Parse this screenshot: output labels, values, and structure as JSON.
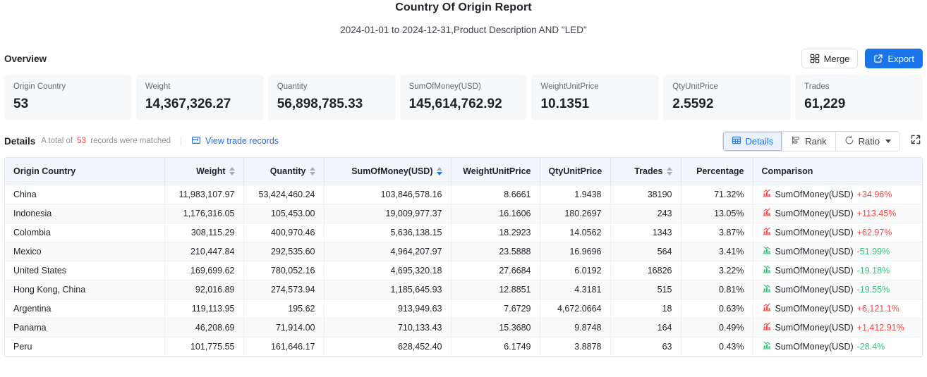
{
  "header": {
    "title": "Country Of Origin Report",
    "subtitle": "2024-01-01 to 2024-12-31,Product Description AND \"LED\""
  },
  "overview": {
    "label": "Overview",
    "merge_label": "Merge",
    "export_label": "Export",
    "cards": [
      {
        "label": "Origin Country",
        "value": "53"
      },
      {
        "label": "Weight",
        "value": "14,367,326.27"
      },
      {
        "label": "Quantity",
        "value": "56,898,785.33"
      },
      {
        "label": "SumOfMoney(USD)",
        "value": "145,614,762.92"
      },
      {
        "label": "WeightUnitPrice",
        "value": "10.1351"
      },
      {
        "label": "QtyUnitPrice",
        "value": "2.5592"
      },
      {
        "label": "Trades",
        "value": "61,229"
      }
    ]
  },
  "details": {
    "title": "Details",
    "meta_prefix": "A total of",
    "count": "53",
    "meta_suffix": "records were matched",
    "view_trade_records": "View trade records",
    "seg_details": "Details",
    "seg_rank": "Rank",
    "seg_ratio": "Ratio"
  },
  "table": {
    "columns": [
      {
        "label": "Origin Country",
        "align": "left",
        "sortable": false,
        "sort": "none"
      },
      {
        "label": "Weight",
        "align": "right",
        "sortable": true,
        "sort": "none"
      },
      {
        "label": "Quantity",
        "align": "right",
        "sortable": true,
        "sort": "none"
      },
      {
        "label": "SumOfMoney(USD)",
        "align": "right",
        "sortable": true,
        "sort": "desc"
      },
      {
        "label": "WeightUnitPrice",
        "align": "right",
        "sortable": false,
        "sort": "none"
      },
      {
        "label": "QtyUnitPrice",
        "align": "right",
        "sortable": false,
        "sort": "none"
      },
      {
        "label": "Trades",
        "align": "right",
        "sortable": true,
        "sort": "none"
      },
      {
        "label": "Percentage",
        "align": "right",
        "sortable": false,
        "sort": "none"
      },
      {
        "label": "Comparison",
        "align": "left",
        "sortable": false,
        "sort": "none"
      }
    ],
    "rows": [
      {
        "country": "China",
        "weight": "11,983,107.97",
        "quantity": "53,424,460.24",
        "sum": "103,846,578.16",
        "wup": "8.6661",
        "qup": "1.9438",
        "trades": "38190",
        "percentage": "71.32%",
        "cmp_label": "SumOfMoney(USD)",
        "cmp_value": "+34.96%",
        "cmp_dir": "up"
      },
      {
        "country": "Indonesia",
        "weight": "1,176,316.05",
        "quantity": "105,453.00",
        "sum": "19,009,977.37",
        "wup": "16.1606",
        "qup": "180.2697",
        "trades": "243",
        "percentage": "13.05%",
        "cmp_label": "SumOfMoney(USD)",
        "cmp_value": "+113.45%",
        "cmp_dir": "up"
      },
      {
        "country": "Colombia",
        "weight": "308,115.29",
        "quantity": "400,970.46",
        "sum": "5,636,138.15",
        "wup": "18.2923",
        "qup": "14.0562",
        "trades": "1343",
        "percentage": "3.87%",
        "cmp_label": "SumOfMoney(USD)",
        "cmp_value": "+62.97%",
        "cmp_dir": "up"
      },
      {
        "country": "Mexico",
        "weight": "210,447.84",
        "quantity": "292,535.60",
        "sum": "4,964,207.97",
        "wup": "23.5888",
        "qup": "16.9696",
        "trades": "564",
        "percentage": "3.41%",
        "cmp_label": "SumOfMoney(USD)",
        "cmp_value": "-51.99%",
        "cmp_dir": "down"
      },
      {
        "country": "United States",
        "weight": "169,699.62",
        "quantity": "780,052.16",
        "sum": "4,695,320.18",
        "wup": "27.6684",
        "qup": "6.0192",
        "trades": "16826",
        "percentage": "3.22%",
        "cmp_label": "SumOfMoney(USD)",
        "cmp_value": "-19.18%",
        "cmp_dir": "down"
      },
      {
        "country": "Hong Kong, China",
        "weight": "92,016.89",
        "quantity": "274,573.94",
        "sum": "1,185,645.93",
        "wup": "12.8851",
        "qup": "4.3181",
        "trades": "515",
        "percentage": "0.81%",
        "cmp_label": "SumOfMoney(USD)",
        "cmp_value": "-19.55%",
        "cmp_dir": "down"
      },
      {
        "country": "Argentina",
        "weight": "119,113.95",
        "quantity": "195.62",
        "sum": "913,949.63",
        "wup": "7.6729",
        "qup": "4,672.0664",
        "trades": "18",
        "percentage": "0.63%",
        "cmp_label": "SumOfMoney(USD)",
        "cmp_value": "+6,121.1%",
        "cmp_dir": "up"
      },
      {
        "country": "Panama",
        "weight": "46,208.69",
        "quantity": "71,914.00",
        "sum": "710,133.43",
        "wup": "15.3680",
        "qup": "9.8748",
        "trades": "164",
        "percentage": "0.49%",
        "cmp_label": "SumOfMoney(USD)",
        "cmp_value": "+1,412.91%",
        "cmp_dir": "up"
      },
      {
        "country": "Peru",
        "weight": "101,775.55",
        "quantity": "161,646.17",
        "sum": "628,452.40",
        "wup": "6.1749",
        "qup": "3.8878",
        "trades": "63",
        "percentage": "0.43%",
        "cmp_label": "SumOfMoney(USD)",
        "cmp_value": "-28.4%",
        "cmp_dir": "down"
      }
    ]
  },
  "colors": {
    "primary": "#1a73e8",
    "link": "#2a6fdb",
    "up": "#f54a45",
    "down": "#34c77b",
    "card_bg": "#f7f8fa",
    "header_bg": "#f2f5fb"
  }
}
